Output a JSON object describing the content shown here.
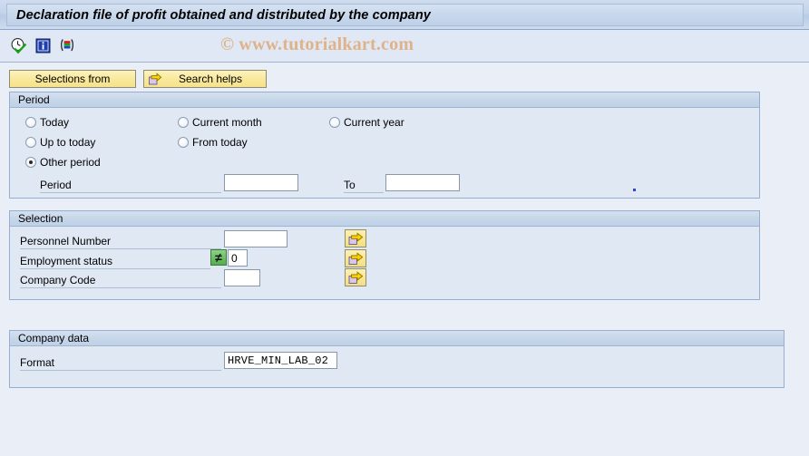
{
  "window": {
    "title": "Declaration file of profit obtained and distributed by the company"
  },
  "toolbar": {
    "icons": [
      {
        "name": "execute-clock-check-icon",
        "tooltip": "Execute"
      },
      {
        "name": "info-icon",
        "tooltip": "Information"
      },
      {
        "name": "variant-stripes-icon",
        "tooltip": "Get Variant"
      }
    ],
    "watermark": "© www.tutorialkart.com"
  },
  "tabs": [
    {
      "label": "Selections from",
      "icon": null
    },
    {
      "label": "Search helps",
      "icon": "yellow-arrow-icon"
    }
  ],
  "period_panel": {
    "title": "Period",
    "options": [
      {
        "label": "Today",
        "checked": false
      },
      {
        "label": "Current month",
        "checked": false
      },
      {
        "label": "Current year",
        "checked": false
      },
      {
        "label": "Up to today",
        "checked": false
      },
      {
        "label": "From today",
        "checked": false
      },
      {
        "label": "Other period",
        "checked": true
      }
    ],
    "period_label": "Period",
    "period_value": "",
    "to_label": "To",
    "to_value": ""
  },
  "selection_panel": {
    "title": "Selection",
    "rows": [
      {
        "label": "Personnel Number",
        "value": "",
        "operator": null,
        "multi_button": "multiple-selection-button"
      },
      {
        "label": "Employment status",
        "value": "0",
        "operator": "≠",
        "multi_button": "multiple-selection-button"
      },
      {
        "label": "Company Code",
        "value": "",
        "operator": null,
        "multi_button": "multiple-selection-button"
      }
    ]
  },
  "company_panel": {
    "title": "Company data",
    "format_label": "Format",
    "format_value": "HRVE_MIN_LAB_02"
  },
  "colors": {
    "page_background": "#eaeff7",
    "panel_background": "#dfe8f3",
    "panel_border": "#94afd0",
    "title_bar": "#c8d8ec",
    "tab_yellow": "#f9e99c",
    "watermark": "#e0b084",
    "operator_green": "#6cbd66"
  }
}
